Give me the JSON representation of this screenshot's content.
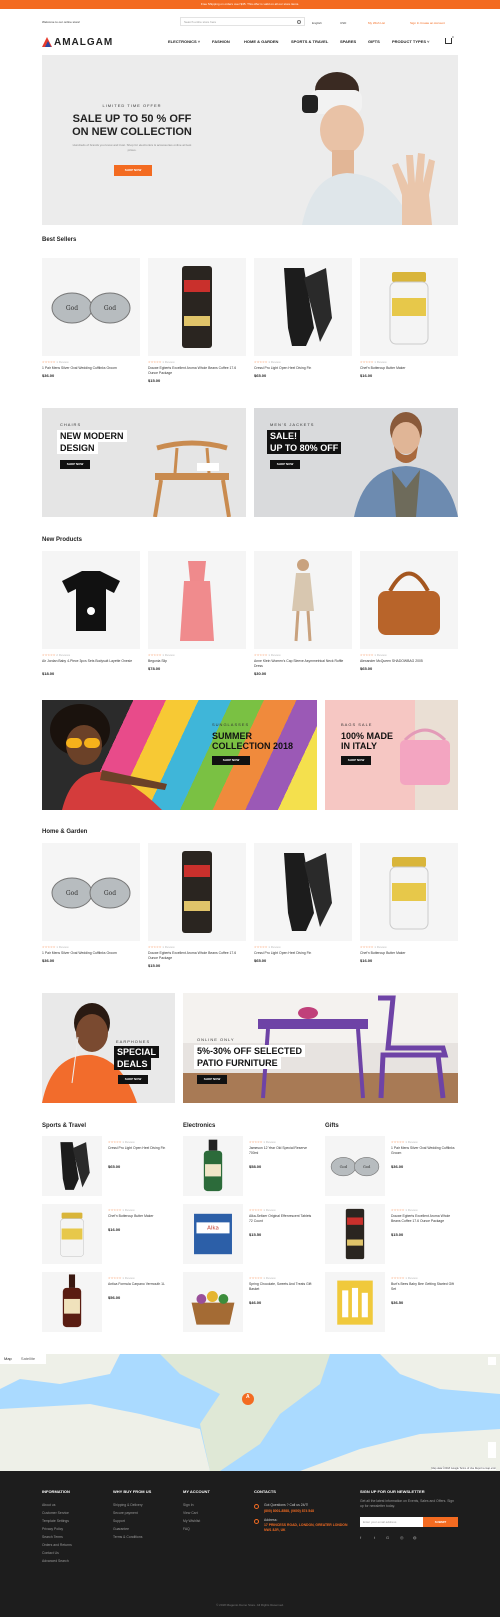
{
  "topbar": {
    "text": "Free Shipping on orders over $35. This offer is valid on all our store items."
  },
  "header": {
    "welcome": "Welcome to our online store!",
    "search_placeholder": "Search entire store here",
    "currency": "USD",
    "language": "English",
    "wishlist": "My Wish List",
    "account": "Sign In  Create an Account",
    "logo": "AMALGAM",
    "cart_count": "0",
    "nav": [
      "ELECTRONICS ˅",
      "FASHION",
      "HOME & GARDEN",
      "SPORTS & TRAVEL",
      "SPARES",
      "GIFTS",
      "PRODUCT TYPES ˅"
    ]
  },
  "hero": {
    "tag": "LIMITED TIME OFFER",
    "title_line1": "SALE UP TO 50 % OFF",
    "title_line2": "ON NEW COLLECTION",
    "subtitle": "Hundreds of brands you know and trust. Shop for electronics & accessories online at best prices.",
    "button": "SHOP NOW"
  },
  "best_sellers": {
    "title": "Best Sellers",
    "products": [
      {
        "name": "1 Pair Mens Silver Oval Wedding Cufflinks Groom",
        "price": "$36.00",
        "reviews": "1 Review"
      },
      {
        "name": "Douwe Egberts Excellent Aroma Whole Beans Coffee 17.6 Ounce Package",
        "price": "$15.00",
        "reviews": "1 Review"
      },
      {
        "name": "Cressi Pro Light Open Heel Diving Fin",
        "price": "$65.00",
        "reviews": "1 Review"
      },
      {
        "name": "Chef'n Buttercup Butter Maker",
        "price": "$16.00",
        "reviews": "1 Review"
      }
    ]
  },
  "banner_row1": [
    {
      "tag": "CHAIRS",
      "title1": "NEW MODERN",
      "title2": "DESIGN",
      "button": "SHOP NOW"
    },
    {
      "tag": "MEN'S JACKETS",
      "title1": "SALE!",
      "title2": "UP TO 80% OFF",
      "button": "SHOP NOW"
    }
  ],
  "new_products": {
    "title": "New Products",
    "products": [
      {
        "name": "Air Jordan Baby 4-Piece 3pcs Sets Bodysuit Layette Onesie",
        "price": "$18.00",
        "reviews": "2 Reviews"
      },
      {
        "name": "Begonia Slip",
        "price": "$78.00",
        "reviews": "1 Review"
      },
      {
        "name": "Anne Klein Women's Cap Sleeve Asymmetrical Neck Ruffle Dress",
        "price": "$30.00",
        "reviews": "1 Review"
      },
      {
        "name": "Alexander McQueen SHADOWBAG 2005",
        "price": "$65.00",
        "reviews": "1 Review"
      }
    ]
  },
  "banner_row2": [
    {
      "tag": "SUNGLASSES",
      "title1": "SUMMER",
      "title2": "COLLECTION 2018",
      "button": "SHOP NOW"
    },
    {
      "tag": "BAGS SALE",
      "title1": "100% MADE",
      "title2": "IN ITALY",
      "button": "SHOP NOW"
    }
  ],
  "home_garden": {
    "title": "Home & Garden",
    "products": [
      {
        "name": "1 Pair Mens Silver Oval Wedding Cufflinks Groom",
        "price": "$36.00",
        "reviews": "1 Review"
      },
      {
        "name": "Douwe Egberts Excellent Aroma Whole Beans Coffee 17.6 Ounce Package",
        "price": "$15.00",
        "reviews": "1 Review"
      },
      {
        "name": "Cressi Pro Light Open Heel Diving Fin",
        "price": "$65.00",
        "reviews": "1 Review"
      },
      {
        "name": "Chef'n Buttercup Butter Maker",
        "price": "$16.00",
        "reviews": "1 Review"
      }
    ]
  },
  "banner_row3": [
    {
      "tag": "EARPHONES",
      "title1": "SPECIAL",
      "title2": "DEALS",
      "button": "SHOP NOW"
    },
    {
      "tag": "ONLINE ONLY",
      "title1": "5%-30% OFF SELECTED",
      "title2": "PATIO FURNITURE",
      "button": "SHOP NOW"
    }
  ],
  "columns": [
    {
      "title": "Sports & Travel",
      "items": [
        {
          "name": "Cressi Pro Light Open Heel Diving Fin",
          "price": "$65.00",
          "reviews": "1 Review"
        },
        {
          "name": "Chef'n Buttercup Butter Maker",
          "price": "$16.00",
          "reviews": "1 Review"
        },
        {
          "name": "Antica Formula Carpano Vermouth 1L",
          "price": "$56.00",
          "reviews": "1 Review"
        }
      ]
    },
    {
      "title": "Electronics",
      "items": [
        {
          "name": "Jameson 12 Year Old Special Reserve 700ml",
          "price": "$58.00",
          "reviews": "1 Review"
        },
        {
          "name": "Alka-Seltzer Original Effervescent Tablets 72 Count",
          "price": "$15.50",
          "reviews": "1 Review"
        },
        {
          "name": "Spring Chocolate, Sweets And Treats Gift Basket",
          "price": "$46.00",
          "reviews": "1 Review"
        }
      ]
    },
    {
      "title": "Gifts",
      "items": [
        {
          "name": "1 Pair Mens Silver Oval Wedding Cufflinks Groom",
          "price": "$36.00",
          "reviews": "1 Review"
        },
        {
          "name": "Douwe Egberts Excellent Aroma Whole Beans Coffee 17.6 Ounce Package",
          "price": "$15.00",
          "reviews": "1 Review"
        },
        {
          "name": "Burt's Bees Baby Bee Getting Started Gift Set",
          "price": "$36.50",
          "reviews": "1 Review"
        }
      ]
    }
  ],
  "map": {
    "tab_map": "Map",
    "tab_satellite": "Satellite",
    "marker": "A",
    "attribution": "Map data ©2018 Google  Terms of Use  Report a map error"
  },
  "footer": {
    "information": {
      "title": "INFORMATION",
      "links": [
        "About us",
        "Customer Service",
        "Template Settings",
        "Privacy Policy",
        "Search Terms",
        "Orders and Returns",
        "Contact Us",
        "Advanced Search"
      ]
    },
    "why_buy": {
      "title": "WHY BUY FROM US",
      "links": [
        "Shipping & Delivery",
        "Secure payment",
        "Support",
        "Guarantee",
        "Terms & Conditions"
      ]
    },
    "account": {
      "title": "MY ACCOUNT",
      "links": [
        "Sign In",
        "View Cart",
        "My Wishlist",
        "FAQ"
      ]
    },
    "contacts": {
      "title": "CONTACTS",
      "question": "Got Questions ? Call us 24/7!",
      "phone": "(800) 8001-8588, (0600) 874 548",
      "address_label": "Address:",
      "address": "17 PRINCESS ROAD, LONDON, GREATER LONDON NW1 8JR, UK"
    },
    "newsletter": {
      "title": "SIGN UP FOR OUR NEWSLETTER",
      "text": "Get all the latest information on Events, Sales and Offers. Sign up for newsletter today.",
      "placeholder": "Enter your email address",
      "button": "SUBMIT"
    },
    "copyright": "© 2018 Magento Demo Store. All Rights Reserved."
  },
  "colors": {
    "accent": "#f36b21",
    "footer_bg": "#1d1d1d"
  }
}
